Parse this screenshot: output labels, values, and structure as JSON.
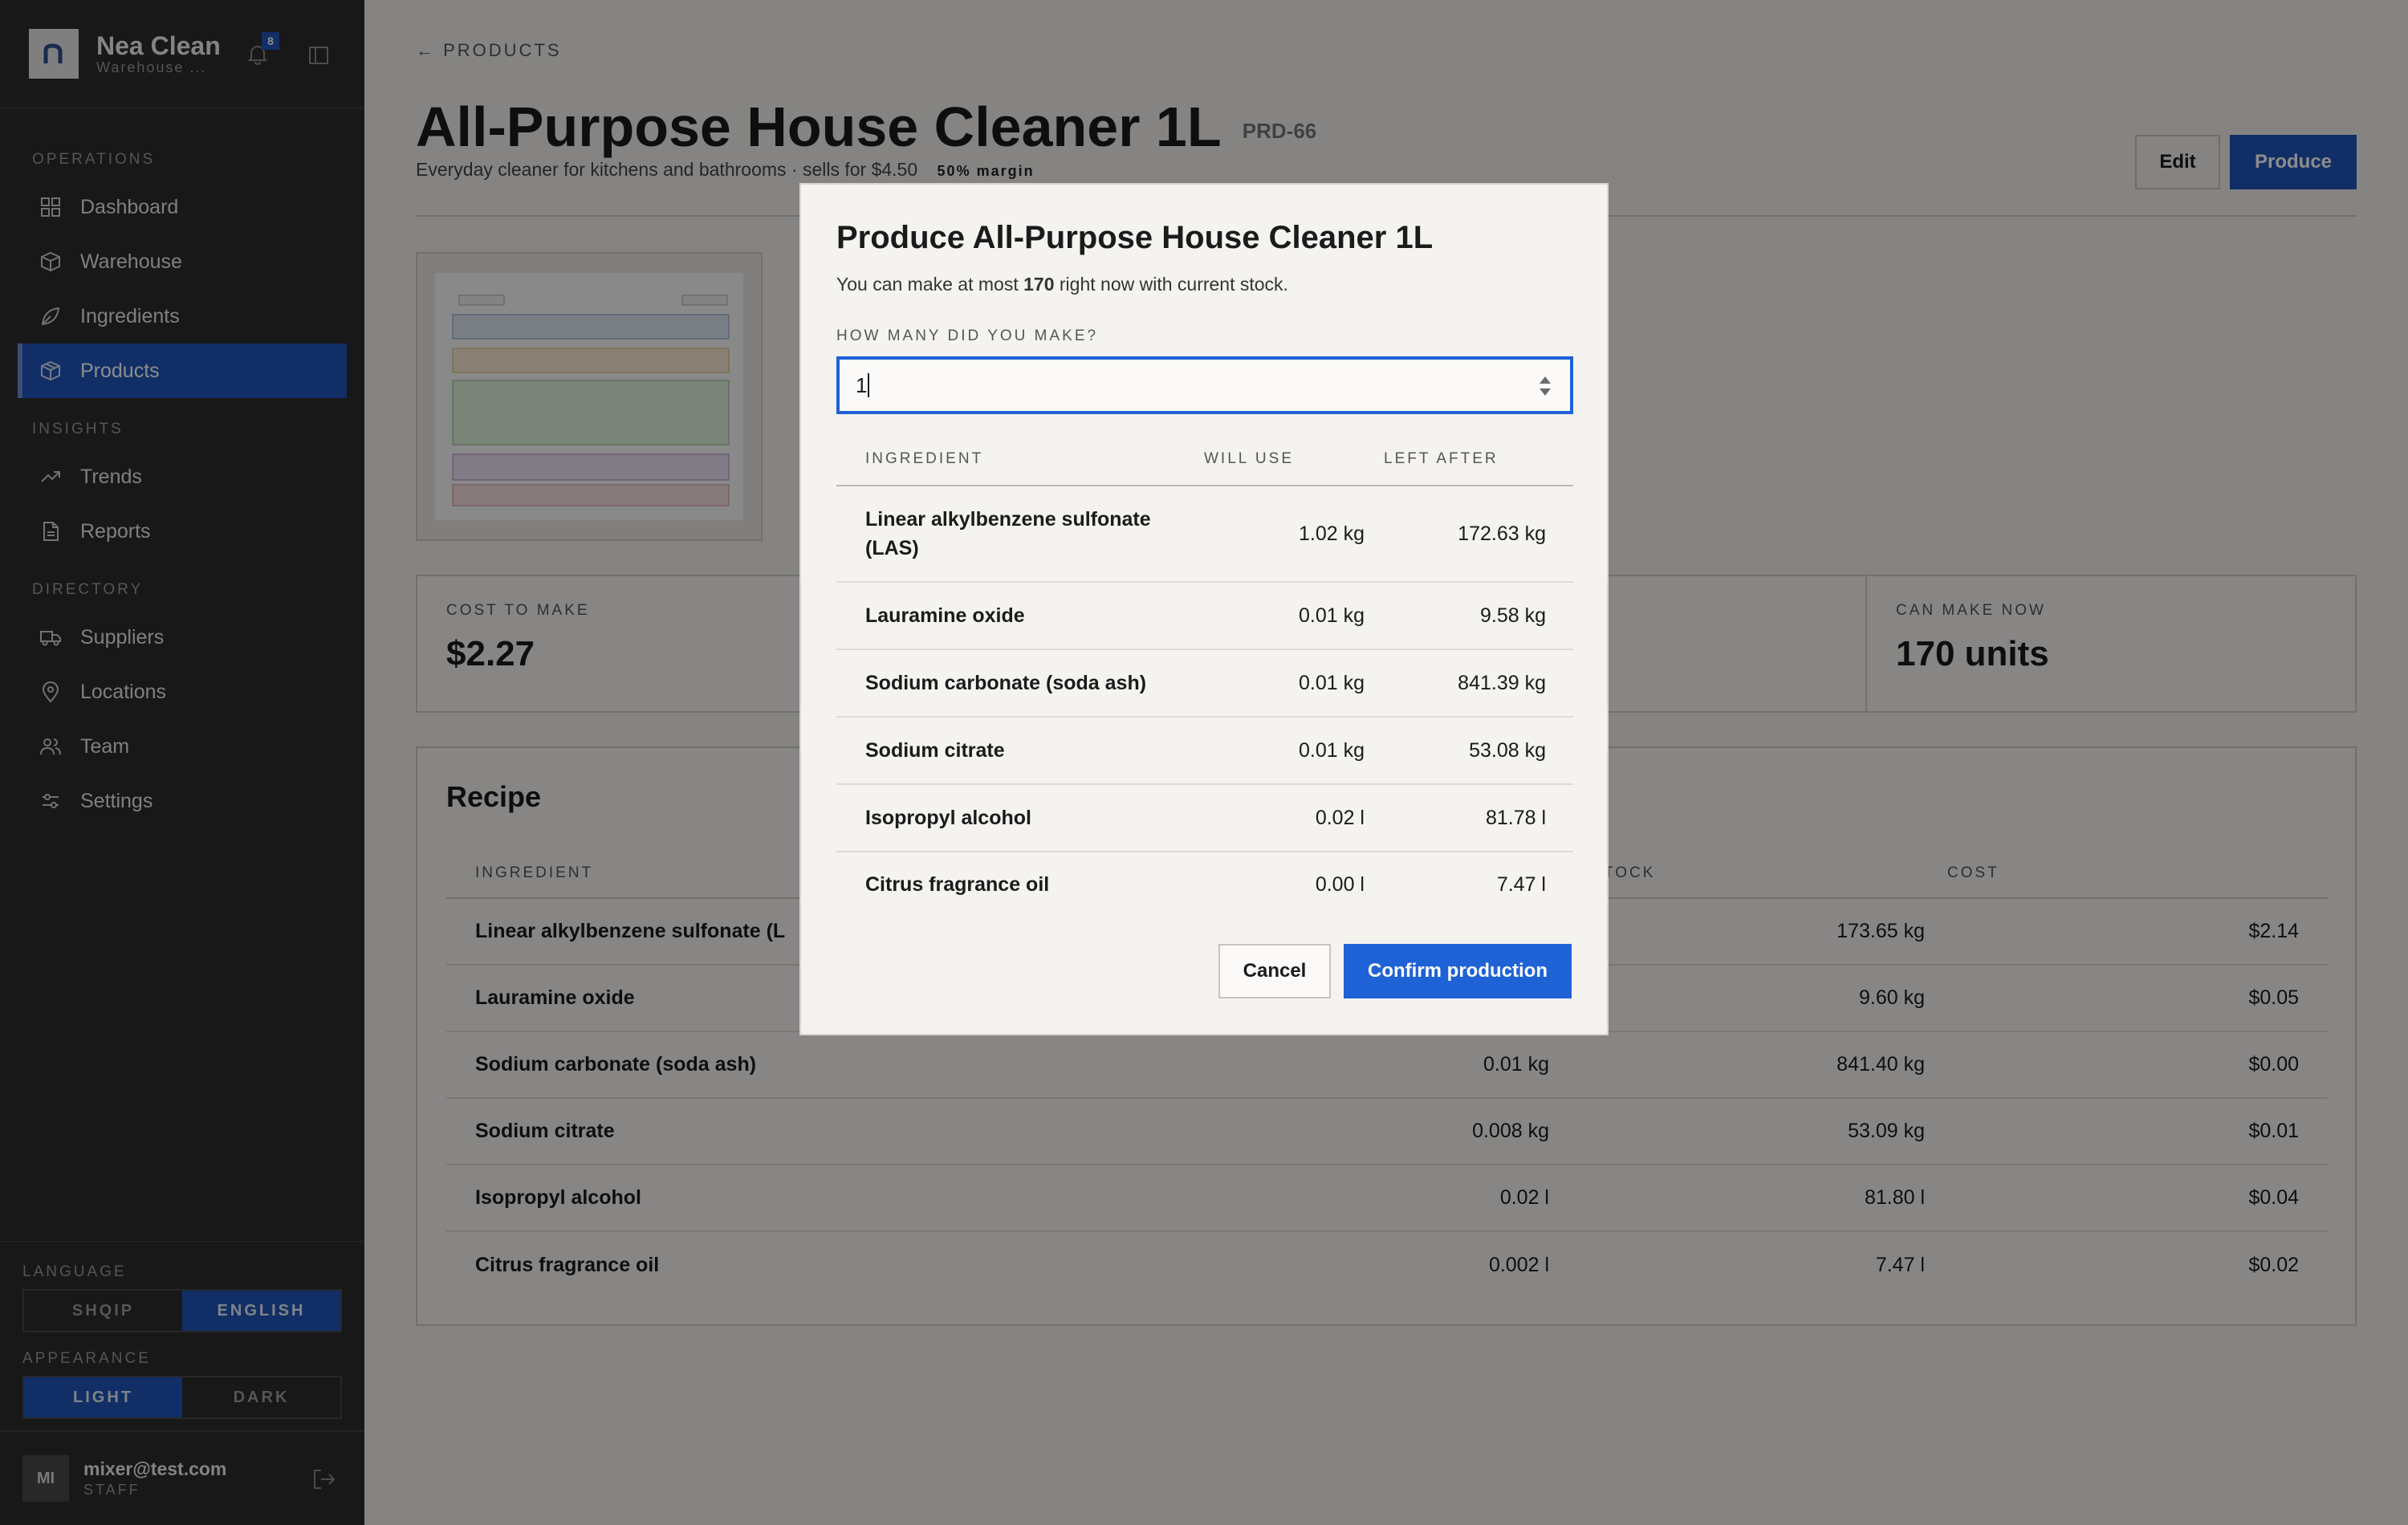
{
  "brand": {
    "name": "Nea Clean",
    "subtitle": "Warehouse ...",
    "notification_count": "8"
  },
  "nav": {
    "groups": [
      {
        "label": "OPERATIONS",
        "items": [
          {
            "label": "Dashboard",
            "icon": "grid-icon"
          },
          {
            "label": "Warehouse",
            "icon": "box-icon"
          },
          {
            "label": "Ingredients",
            "icon": "leaf-icon"
          },
          {
            "label": "Products",
            "icon": "package-icon",
            "active": true
          }
        ]
      },
      {
        "label": "INSIGHTS",
        "items": [
          {
            "label": "Trends",
            "icon": "trend-up-icon"
          },
          {
            "label": "Reports",
            "icon": "document-icon"
          }
        ]
      },
      {
        "label": "DIRECTORY",
        "items": [
          {
            "label": "Suppliers",
            "icon": "truck-icon"
          },
          {
            "label": "Locations",
            "icon": "map-pin-icon"
          },
          {
            "label": "Team",
            "icon": "users-icon"
          },
          {
            "label": "Settings",
            "icon": "sliders-icon"
          }
        ]
      }
    ]
  },
  "language": {
    "label": "LANGUAGE",
    "options": [
      "SHQIP",
      "ENGLISH"
    ],
    "selected": "ENGLISH"
  },
  "appearance": {
    "label": "APPEARANCE",
    "options": [
      "LIGHT",
      "DARK"
    ],
    "selected": "LIGHT"
  },
  "user": {
    "initials": "MI",
    "email": "mixer@test.com",
    "role": "STAFF"
  },
  "page": {
    "back_link": "← PRODUCTS",
    "title": "All-Purpose House Cleaner 1L",
    "sku": "PRD-66",
    "subtitle": "Everyday cleaner for kitchens and bathrooms · sells for $4.50",
    "margin_tag": "50% margin",
    "edit_label": "Edit",
    "produce_label": "Produce"
  },
  "stats": {
    "cost_label": "COST TO MAKE",
    "cost_value": "$2.27",
    "can_make_label": "CAN MAKE NOW",
    "can_make_value": "170 units"
  },
  "recipe": {
    "title": "Recipe",
    "headers": {
      "ingredient": "INGREDIENT",
      "stock": "TOCK",
      "cost": "COST"
    },
    "rows": [
      {
        "name": "Linear alkylbenzene sulfonate (L",
        "amount": "",
        "stock": "173.65 kg",
        "cost": "$2.14"
      },
      {
        "name": "Lauramine oxide",
        "amount": "",
        "stock": "9.60 kg",
        "cost": "$0.05"
      },
      {
        "name": "Sodium carbonate (soda ash)",
        "amount": "0.01 kg",
        "stock": "841.40 kg",
        "cost": "$0.00"
      },
      {
        "name": "Sodium citrate",
        "amount": "0.008 kg",
        "stock": "53.09 kg",
        "cost": "$0.01"
      },
      {
        "name": "Isopropyl alcohol",
        "amount": "0.02 l",
        "stock": "81.80 l",
        "cost": "$0.04"
      },
      {
        "name": "Citrus fragrance oil",
        "amount": "0.002 l",
        "stock": "7.47 l",
        "cost": "$0.02"
      }
    ]
  },
  "modal": {
    "title": "Produce All-Purpose House Cleaner 1L",
    "subtitle_pre": "You can make at most ",
    "subtitle_num": "170",
    "subtitle_post": " right now with current stock.",
    "quantity_label": "HOW MANY DID YOU MAKE?",
    "quantity_value": "1",
    "headers": {
      "ingredient": "INGREDIENT",
      "will_use": "WILL USE",
      "left_after": "LEFT AFTER"
    },
    "rows": [
      {
        "name": "Linear alkylbenzene sulfonate (LAS)",
        "will_use": "1.02 kg",
        "left_after": "172.63 kg"
      },
      {
        "name": "Lauramine oxide",
        "will_use": "0.01 kg",
        "left_after": "9.58 kg"
      },
      {
        "name": "Sodium carbonate (soda ash)",
        "will_use": "0.01 kg",
        "left_after": "841.39 kg"
      },
      {
        "name": "Sodium citrate",
        "will_use": "0.01 kg",
        "left_after": "53.08 kg"
      },
      {
        "name": "Isopropyl alcohol",
        "will_use": "0.02 l",
        "left_after": "81.78 l"
      },
      {
        "name": "Citrus fragrance oil",
        "will_use": "0.00 l",
        "left_after": "7.47 l"
      }
    ],
    "cancel_label": "Cancel",
    "confirm_label": "Confirm production"
  },
  "colors": {
    "accent": "#2057ba",
    "modal_accent": "#1f62d6",
    "sidebar": "#2c2c2c"
  }
}
